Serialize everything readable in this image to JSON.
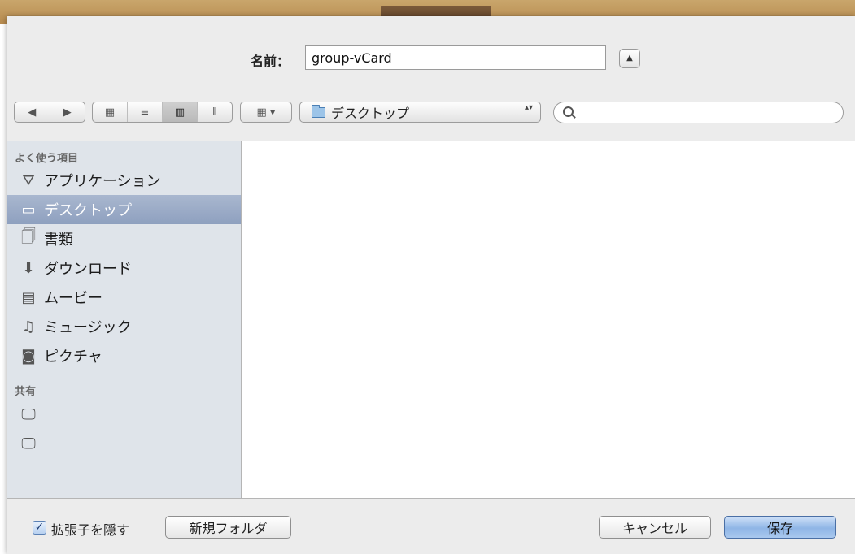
{
  "dialog": {
    "name_label": "名前：",
    "filename": "group-vCard",
    "expand_glyph": "▲"
  },
  "toolbar": {
    "back_glyph": "◀",
    "forward_glyph": "▶",
    "view_icon_glyph": "▦",
    "view_list_glyph": "≡",
    "view_column_glyph": "▥",
    "view_coverflow_glyph": "⦀",
    "arrange_glyph": "▦ ▾",
    "location": "デスクトップ",
    "location_arrows": "▴▾",
    "search_placeholder": ""
  },
  "sidebar": {
    "favorites_header": "よく使う項目",
    "favorites": [
      {
        "label": "アプリケーション",
        "icon": "applications-icon",
        "glyph": "⛛",
        "selected": false
      },
      {
        "label": "デスクトップ",
        "icon": "desktop-icon",
        "glyph": "▭",
        "selected": true
      },
      {
        "label": "書類",
        "icon": "documents-icon",
        "glyph": "🗍",
        "selected": false
      },
      {
        "label": "ダウンロード",
        "icon": "downloads-icon",
        "glyph": "⬇",
        "selected": false
      },
      {
        "label": "ムービー",
        "icon": "movies-icon",
        "glyph": "▤",
        "selected": false
      },
      {
        "label": "ミュージック",
        "icon": "music-icon",
        "glyph": "♫",
        "selected": false
      },
      {
        "label": "ピクチャ",
        "icon": "pictures-icon",
        "glyph": "◙",
        "selected": false
      }
    ],
    "shared_header": "共有",
    "shared": [
      {
        "label": "",
        "icon": "computer-icon",
        "glyph": "🖵"
      },
      {
        "label": "",
        "icon": "computer-icon",
        "glyph": "🖵"
      }
    ]
  },
  "footer": {
    "check_glyph": "✓",
    "hide_extension_label": "拡張子を隠す",
    "new_folder_label": "新規フォルダ",
    "cancel_label": "キャンセル",
    "save_label": "保存"
  },
  "colors": {
    "sidebar_bg": "#dfe4ea",
    "selection": "#98a8c5",
    "default_button": "#8fb5e6"
  }
}
